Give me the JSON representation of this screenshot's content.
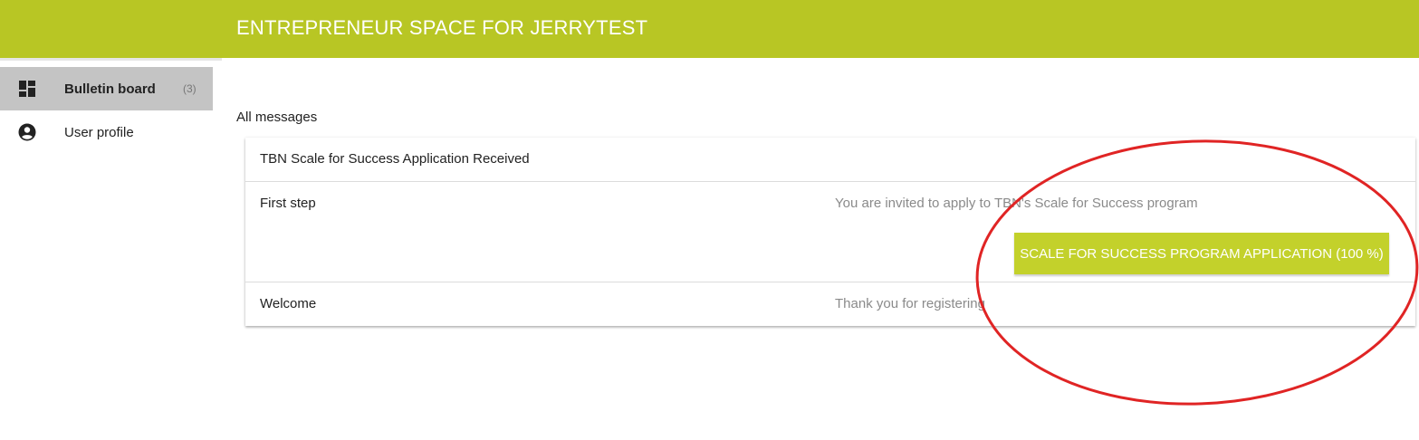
{
  "header": {
    "title": "ENTREPRENEUR SPACE FOR JERRYTEST",
    "bg": "#b8c624"
  },
  "sidebar": {
    "items": [
      {
        "label": "Bulletin board",
        "count": "(3)",
        "icon": "dashboard-icon",
        "active": true
      },
      {
        "label": "User profile",
        "icon": "account-circle-icon",
        "active": false
      }
    ]
  },
  "main": {
    "section_title": "All messages",
    "card": {
      "header": "TBN Scale for Success Application Received",
      "rows": [
        {
          "title": "First step",
          "description": "You are invited to apply to TBN's Scale for Success program",
          "button_label": "SCALE FOR SUCCESS PROGRAM APPLICATION (100 %)"
        },
        {
          "title": "Welcome",
          "description": "Thank you for registering"
        }
      ]
    }
  },
  "colors": {
    "accent": "#c3d12b",
    "annotation": "#e02424"
  }
}
